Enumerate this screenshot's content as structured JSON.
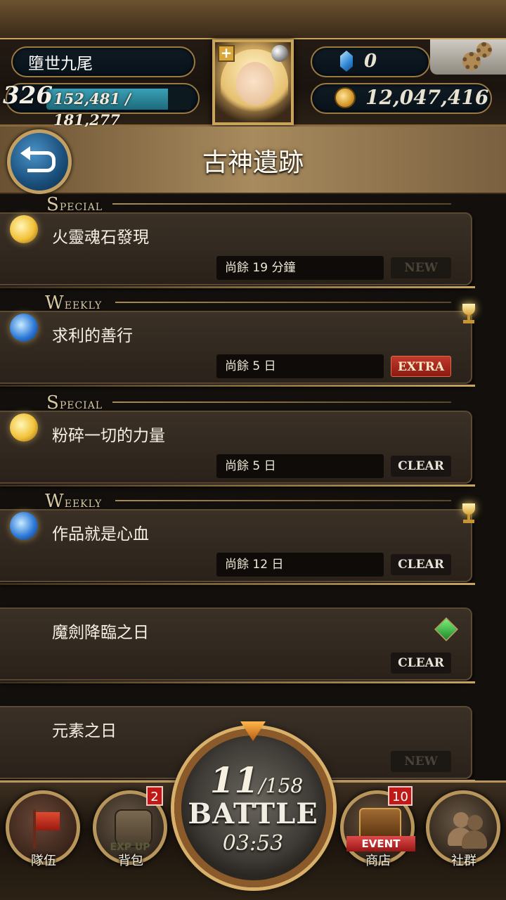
{
  "player": {
    "name": "墮世九尾",
    "level": "326",
    "exp_text": "152,481 / 181,277",
    "exp_fraction": 0.841,
    "gems": "0",
    "gold": "12,047,416"
  },
  "page": {
    "title": "古神遺跡"
  },
  "quests": [
    {
      "tag": "Special",
      "orb": "yellow-orb-icon",
      "name": "火靈魂石發現",
      "time": "尚餘 19 分鐘",
      "badge": "NEW",
      "badge_type": "new"
    },
    {
      "tag": "Weekly",
      "orb": "blue-orb-icon",
      "name": "求利的善行",
      "time": "尚餘 5 日",
      "badge": "EXTRA",
      "badge_type": "extra",
      "icon": "trophy-icon"
    },
    {
      "tag": "Special",
      "orb": "yellow-orb-icon",
      "name": "粉碎一切的力量",
      "time": "尚餘 5 日",
      "badge": "CLEAR",
      "badge_type": "clear"
    },
    {
      "tag": "Weekly",
      "orb": "blue-orb-icon",
      "name": "作品就是心血",
      "time": "尚餘 12 日",
      "badge": "CLEAR",
      "badge_type": "clear",
      "icon": "trophy-icon"
    },
    {
      "tag": "",
      "name": "魔劍降臨之日",
      "time": "",
      "badge": "CLEAR",
      "badge_type": "clear",
      "icon": "sword-icon"
    },
    {
      "tag": "",
      "name": "元素之日",
      "time": "",
      "badge": "NEW",
      "badge_type": "new"
    }
  ],
  "bottom_nav": {
    "team_label": "隊伍",
    "bag_label": "背包",
    "bag_badge": "2",
    "bag_overlay": "EXP UP",
    "shop_label": "商店",
    "shop_badge": "10",
    "shop_ribbon": "EVENT",
    "social_label": "社群"
  },
  "battle": {
    "stamina_current": "11",
    "stamina_max": "/158",
    "label": "BATTLE",
    "timer": "03:53"
  },
  "colors": {
    "gold_trim": "#c9a55e",
    "extra_badge": "#b02a1c",
    "exp_bar": "#2f8aa0"
  }
}
